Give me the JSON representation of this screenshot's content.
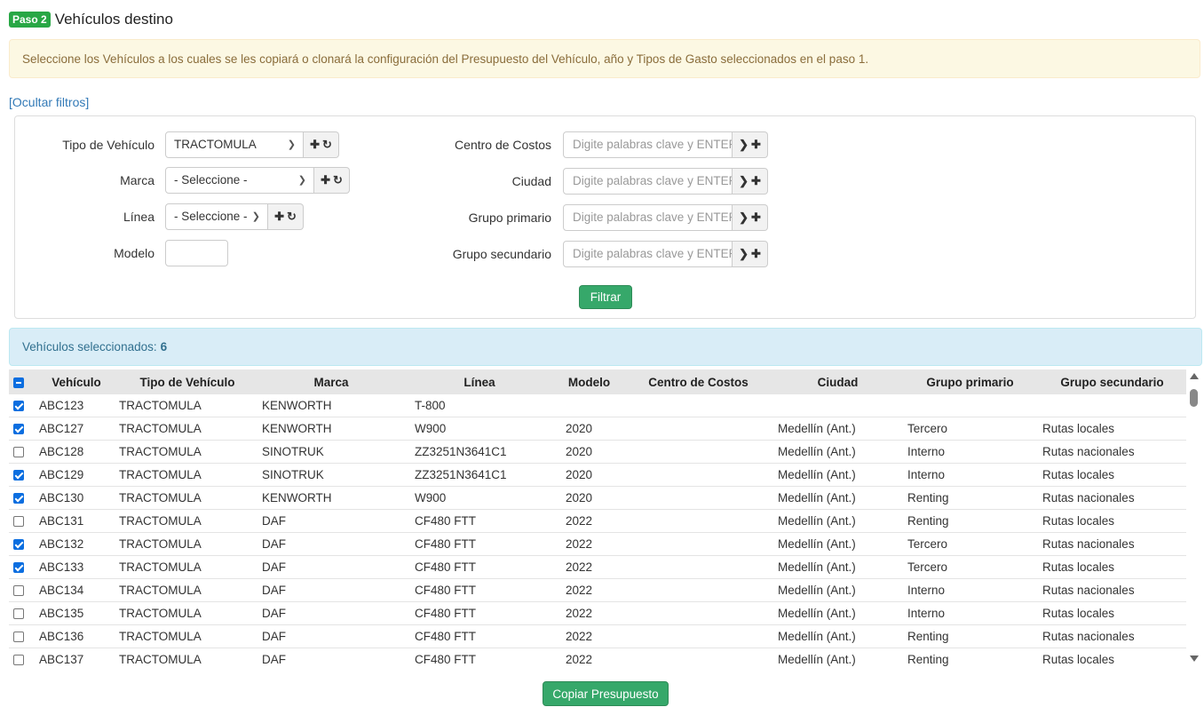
{
  "header": {
    "badge": "Paso 2",
    "title": "Vehículos destino"
  },
  "instructions": "Seleccione los Vehículos a los cuales se les copiará o clonará la configuración del Presupuesto del Vehículo, año y Tipos de Gasto seleccionados en el paso 1.",
  "toggle_filters": "[Ocultar filtros]",
  "filters": {
    "tipo_vehiculo": {
      "label": "Tipo de Vehículo",
      "value": "TRACTOMULA"
    },
    "marca": {
      "label": "Marca",
      "value": "- Seleccione -"
    },
    "linea": {
      "label": "Línea",
      "value": "- Seleccione -"
    },
    "modelo": {
      "label": "Modelo",
      "value": ""
    },
    "centro_costos": {
      "label": "Centro de Costos",
      "placeholder": "Digite palabras clave y ENTER"
    },
    "ciudad": {
      "label": "Ciudad",
      "placeholder": "Digite palabras clave y ENTER"
    },
    "grupo_primario": {
      "label": "Grupo primario",
      "placeholder": "Digite palabras clave y ENTER"
    },
    "grupo_secundario": {
      "label": "Grupo secundario",
      "placeholder": "Digite palabras clave y ENTER"
    },
    "filter_button": "Filtrar"
  },
  "selection": {
    "label": "Vehículos seleccionados:",
    "count": "6"
  },
  "table": {
    "headers": [
      "Vehículo",
      "Tipo de Vehículo",
      "Marca",
      "Línea",
      "Modelo",
      "Centro de Costos",
      "Ciudad",
      "Grupo primario",
      "Grupo secundario"
    ],
    "rows": [
      {
        "checked": true,
        "vehiculo": "ABC123",
        "tipo": "TRACTOMULA",
        "marca": "KENWORTH",
        "linea": "T-800",
        "modelo": "",
        "centro": "",
        "ciudad": "",
        "grupo_primario": "",
        "grupo_secundario": ""
      },
      {
        "checked": true,
        "vehiculo": "ABC127",
        "tipo": "TRACTOMULA",
        "marca": "KENWORTH",
        "linea": "W900",
        "modelo": "2020",
        "centro": "",
        "ciudad": "Medellín (Ant.)",
        "grupo_primario": "Tercero",
        "grupo_secundario": "Rutas locales"
      },
      {
        "checked": false,
        "vehiculo": "ABC128",
        "tipo": "TRACTOMULA",
        "marca": "SINOTRUK",
        "linea": "ZZ3251N3641C1",
        "modelo": "2020",
        "centro": "",
        "ciudad": "Medellín (Ant.)",
        "grupo_primario": "Interno",
        "grupo_secundario": "Rutas nacionales"
      },
      {
        "checked": true,
        "vehiculo": "ABC129",
        "tipo": "TRACTOMULA",
        "marca": "SINOTRUK",
        "linea": "ZZ3251N3641C1",
        "modelo": "2020",
        "centro": "",
        "ciudad": "Medellín (Ant.)",
        "grupo_primario": "Interno",
        "grupo_secundario": "Rutas locales"
      },
      {
        "checked": true,
        "vehiculo": "ABC130",
        "tipo": "TRACTOMULA",
        "marca": "KENWORTH",
        "linea": "W900",
        "modelo": "2020",
        "centro": "",
        "ciudad": "Medellín (Ant.)",
        "grupo_primario": "Renting",
        "grupo_secundario": "Rutas nacionales"
      },
      {
        "checked": false,
        "vehiculo": "ABC131",
        "tipo": "TRACTOMULA",
        "marca": "DAF",
        "linea": "CF480 FTT",
        "modelo": "2022",
        "centro": "",
        "ciudad": "Medellín (Ant.)",
        "grupo_primario": "Renting",
        "grupo_secundario": "Rutas locales"
      },
      {
        "checked": true,
        "vehiculo": "ABC132",
        "tipo": "TRACTOMULA",
        "marca": "DAF",
        "linea": "CF480 FTT",
        "modelo": "2022",
        "centro": "",
        "ciudad": "Medellín (Ant.)",
        "grupo_primario": "Tercero",
        "grupo_secundario": "Rutas nacionales"
      },
      {
        "checked": true,
        "vehiculo": "ABC133",
        "tipo": "TRACTOMULA",
        "marca": "DAF",
        "linea": "CF480 FTT",
        "modelo": "2022",
        "centro": "",
        "ciudad": "Medellín (Ant.)",
        "grupo_primario": "Tercero",
        "grupo_secundario": "Rutas locales"
      },
      {
        "checked": false,
        "vehiculo": "ABC134",
        "tipo": "TRACTOMULA",
        "marca": "DAF",
        "linea": "CF480 FTT",
        "modelo": "2022",
        "centro": "",
        "ciudad": "Medellín (Ant.)",
        "grupo_primario": "Interno",
        "grupo_secundario": "Rutas nacionales"
      },
      {
        "checked": false,
        "vehiculo": "ABC135",
        "tipo": "TRACTOMULA",
        "marca": "DAF",
        "linea": "CF480 FTT",
        "modelo": "2022",
        "centro": "",
        "ciudad": "Medellín (Ant.)",
        "grupo_primario": "Interno",
        "grupo_secundario": "Rutas locales"
      },
      {
        "checked": false,
        "vehiculo": "ABC136",
        "tipo": "TRACTOMULA",
        "marca": "DAF",
        "linea": "CF480 FTT",
        "modelo": "2022",
        "centro": "",
        "ciudad": "Medellín (Ant.)",
        "grupo_primario": "Renting",
        "grupo_secundario": "Rutas nacionales"
      },
      {
        "checked": false,
        "vehiculo": "ABC137",
        "tipo": "TRACTOMULA",
        "marca": "DAF",
        "linea": "CF480 FTT",
        "modelo": "2022",
        "centro": "",
        "ciudad": "Medellín (Ant.)",
        "grupo_primario": "Renting",
        "grupo_secundario": "Rutas locales"
      }
    ]
  },
  "copy_button": "Copiar Presupuesto"
}
